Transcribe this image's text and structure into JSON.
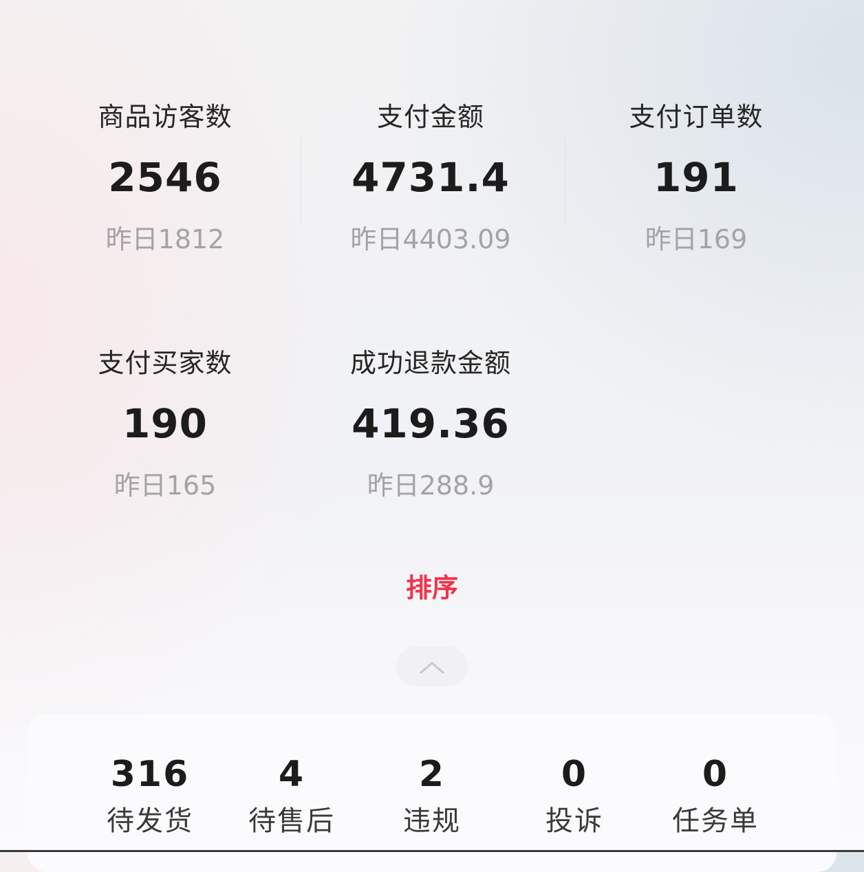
{
  "metrics": [
    {
      "label": "商品访客数",
      "value": "2546",
      "yesterday": "昨日1812"
    },
    {
      "label": "支付金额",
      "value": "4731.4",
      "yesterday": "昨日4403.09"
    },
    {
      "label": "支付订单数",
      "value": "191",
      "yesterday": "昨日169"
    },
    {
      "label": "支付买家数",
      "value": "190",
      "yesterday": "昨日165"
    },
    {
      "label": "成功退款金额",
      "value": "419.36",
      "yesterday": "昨日288.9"
    }
  ],
  "sort": {
    "label": "排序"
  },
  "collapse": {
    "icon": "chevron-up-icon"
  },
  "todos": [
    {
      "count": "316",
      "label": "待发货"
    },
    {
      "count": "4",
      "label": "待售后"
    },
    {
      "count": "2",
      "label": "违规"
    },
    {
      "count": "0",
      "label": "投诉"
    },
    {
      "count": "0",
      "label": "任务单"
    }
  ],
  "colors": {
    "accent": "#f2334b",
    "value_text": "#1c1c1c",
    "secondary_text": "#a3a3a6"
  }
}
